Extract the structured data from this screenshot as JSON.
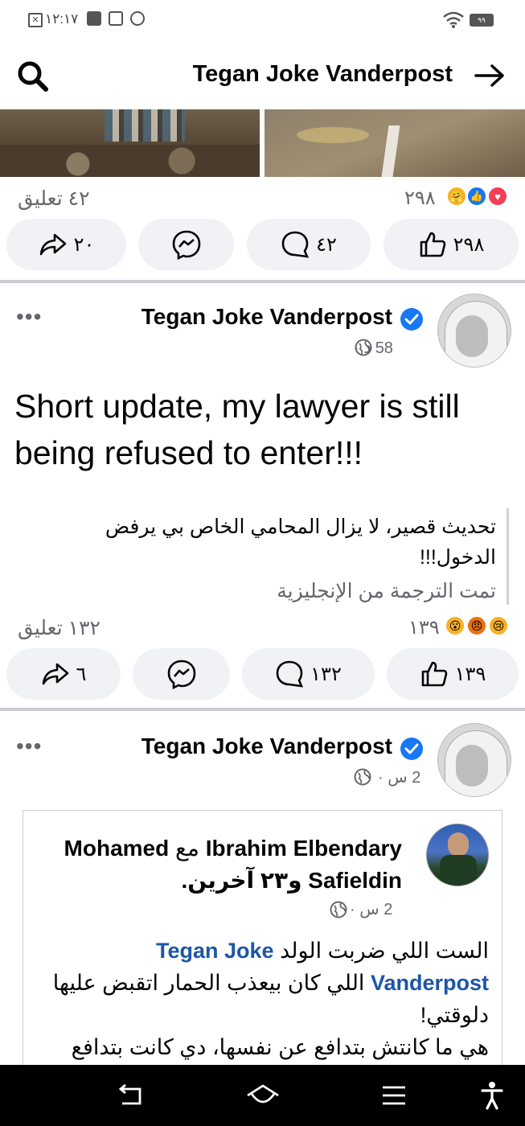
{
  "status_bar": {
    "time": "١٢:١٧",
    "battery": "٩٩"
  },
  "header": {
    "title": "Tegan Joke Vanderpost"
  },
  "post1": {
    "comments_count": "٤٢ تعليق",
    "reactions_count": "٢٩٨",
    "actions": {
      "share_count": "٢٠",
      "comment_count": "٤٢",
      "like_count": "٢٩٨"
    }
  },
  "post2": {
    "author": "Tegan Joke Vanderpost",
    "time": "58 د",
    "text": "Short update, my lawyer is still being refused to enter!!!",
    "translation": "تحديث قصير، لا يزال المحامي الخاص بي يرفض الدخول!!!",
    "translated_from": "تمت الترجمة من الإنجليزية",
    "comments_count": "١٣٢ تعليق",
    "reactions_count": "١٣٩",
    "actions": {
      "share_count": "٦",
      "comment_count": "١٣٢",
      "like_count": "١٣٩"
    }
  },
  "post3": {
    "author": "Tegan Joke Vanderpost",
    "time": "2 س",
    "shared": {
      "author_line1": "Mohamed",
      "with_word": "مع",
      "author_name2": "Ibrahim Elbendary",
      "author_line2": "Safieldin",
      "and_others": "و٢٣ آخرين.",
      "time": "2 س",
      "text_part1": "الست اللي ضربت الولد",
      "mention": "Tegan Joke Vanderpost",
      "text_part2": "اللي كان بيعذب الحمار اتقبض عليها دلوقتي!",
      "text_part3": "هي ما كانتش بتدافع عن نفسها، دي كانت بتدافع عن"
    }
  },
  "icons": {
    "search": "search-icon",
    "forward": "arrow-right-icon",
    "globe": "globe-icon",
    "more": "more-dots-icon",
    "verified": "verified-badge-icon",
    "like": "like-icon",
    "comment": "comment-icon",
    "messenger": "messenger-icon",
    "share": "share-icon",
    "back": "back-icon",
    "home": "home-icon",
    "menu": "menu-icon",
    "accessibility": "accessibility-icon"
  },
  "colors": {
    "accent": "#1877f2",
    "link": "#1c56a8",
    "pill_bg": "#f0f2f5",
    "muted": "#65676b"
  }
}
